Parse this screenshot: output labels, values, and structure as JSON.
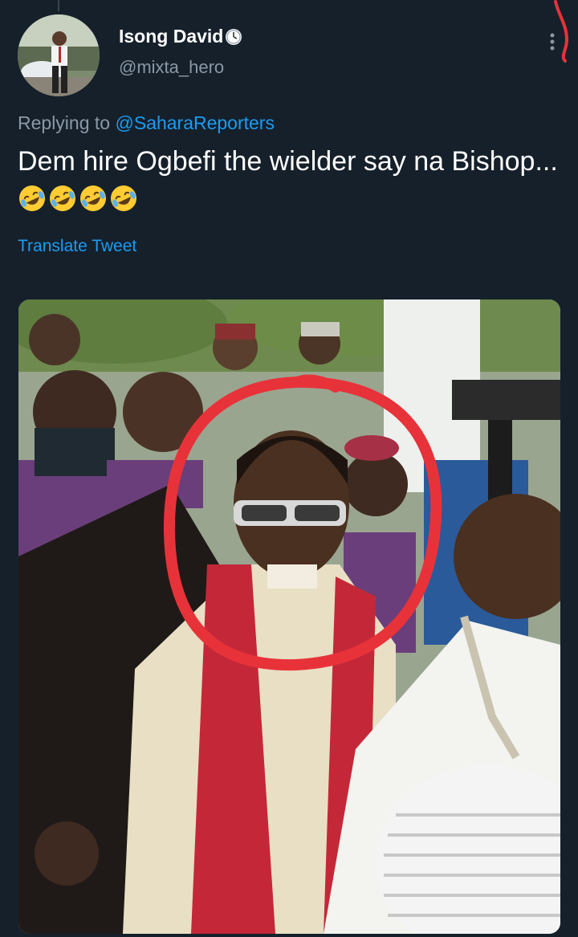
{
  "tweet": {
    "display_name": "Isong David",
    "handle": "@mixta_hero",
    "replying_prefix": "Replying to",
    "replying_to": "@SaharaReporters",
    "text": "Dem hire Ogbefi the wielder say na Bishop...",
    "emojis": [
      "rolling-laughing-emoji",
      "rolling-laughing-emoji",
      "rolling-laughing-emoji",
      "rolling-laughing-emoji"
    ],
    "translate_label": "Translate Tweet"
  },
  "colors": {
    "background": "#15202b",
    "link": "#1d9bf0",
    "secondary_text": "#8b98a5",
    "highlight_circle": "#e8323a"
  },
  "icons": {
    "verified_like_badge": "clock-icon",
    "more_menu": "more-options-icon"
  }
}
